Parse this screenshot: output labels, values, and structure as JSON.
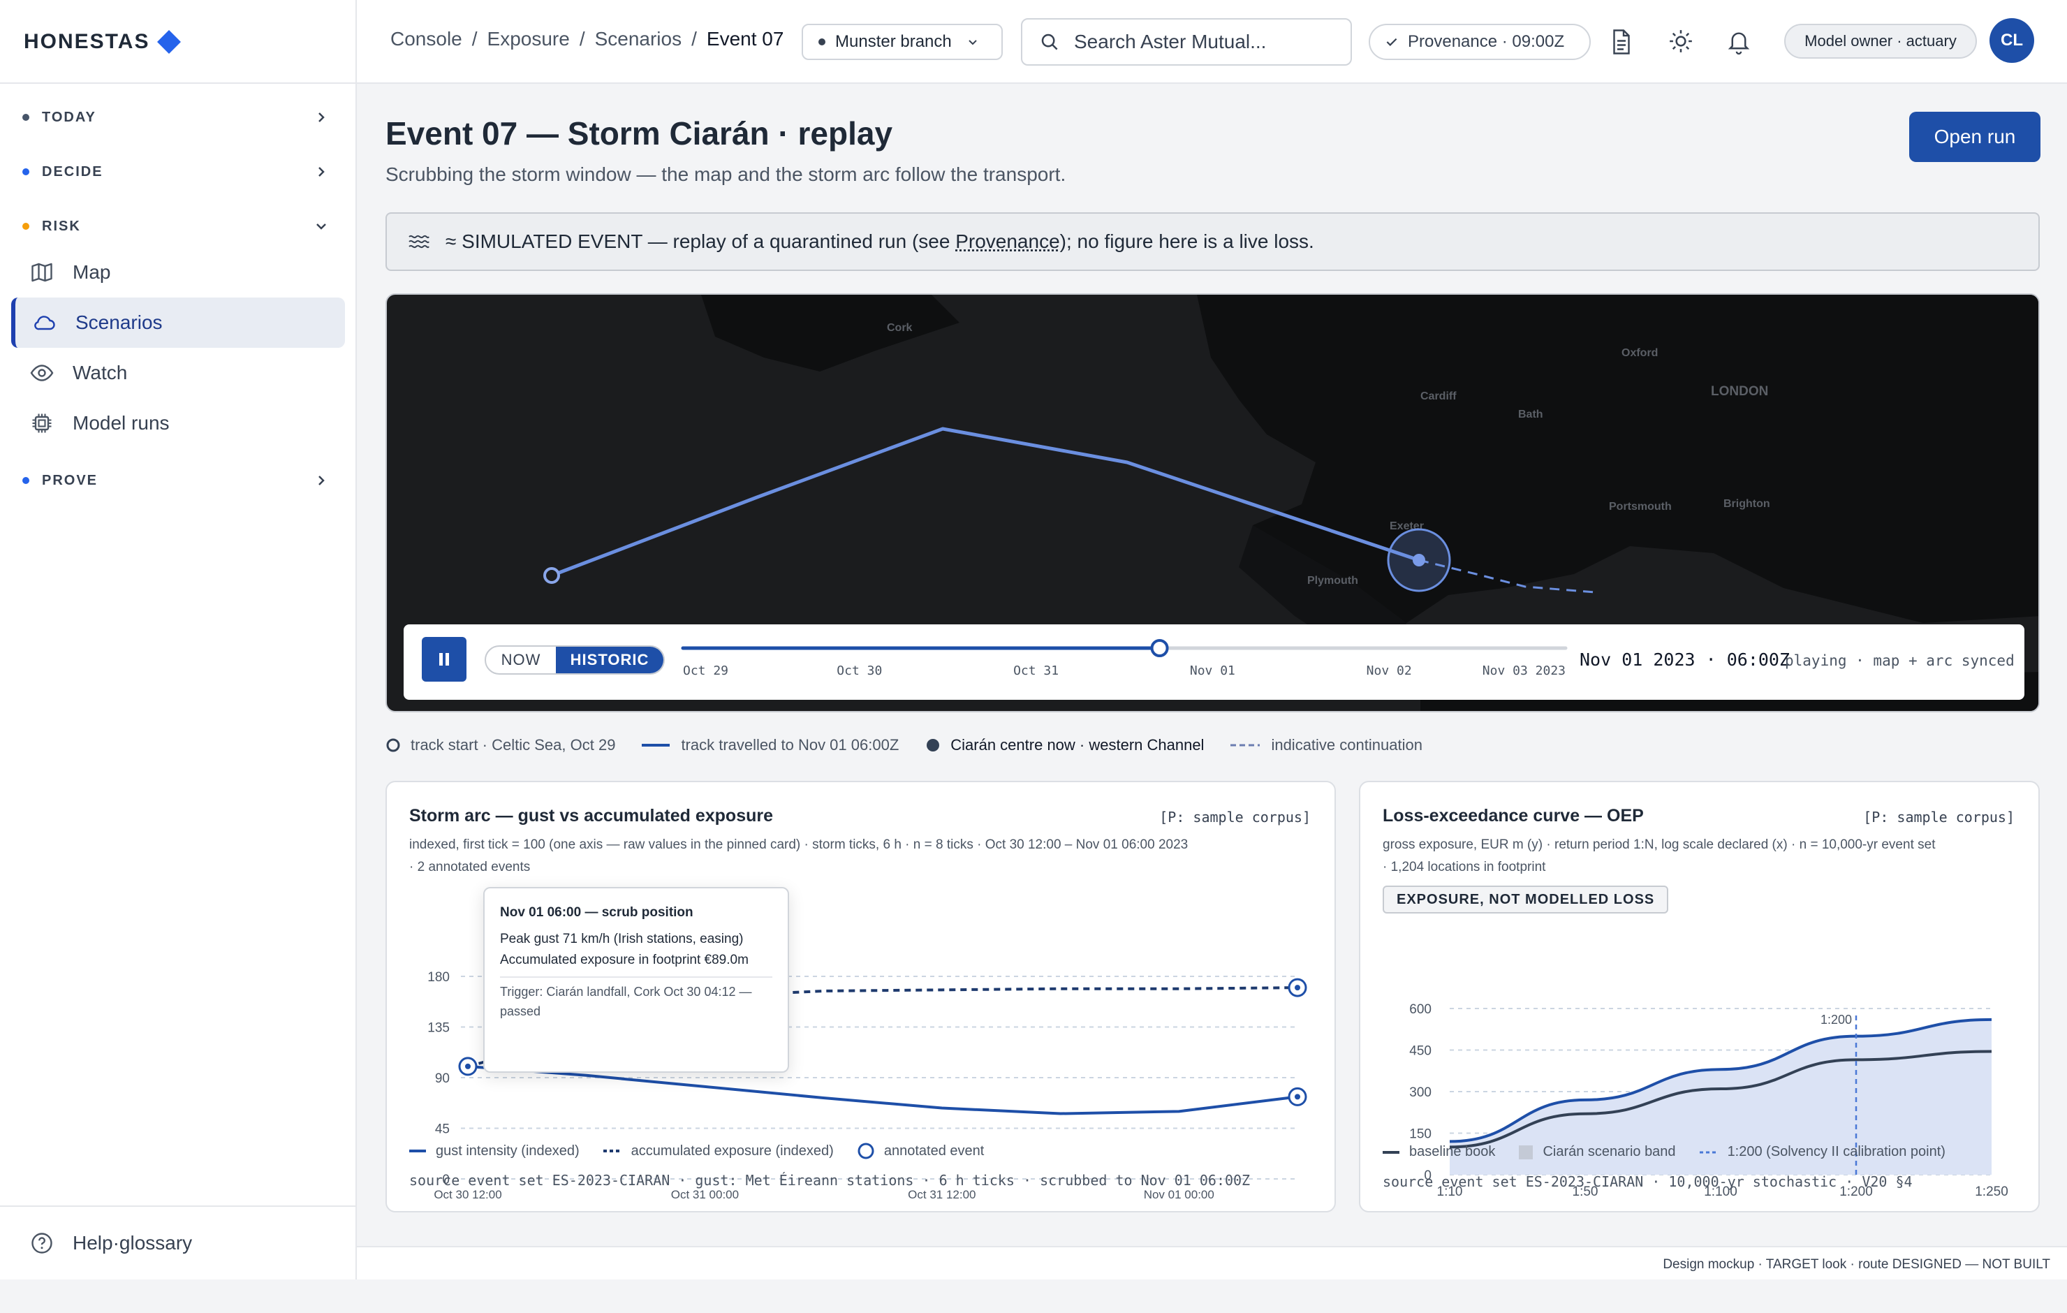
{
  "brand": {
    "name": "HONESTAS"
  },
  "sidebar": {
    "groups": [
      {
        "label": "TODAY",
        "color": "#475569"
      },
      {
        "label": "DECIDE",
        "color": "#2563eb"
      },
      {
        "label": "RISK",
        "color": "#f59e0b"
      },
      {
        "label": "PROVE",
        "color": "#2563eb"
      }
    ],
    "items": [
      {
        "label": "Map",
        "icon": "map-icon"
      },
      {
        "label": "Scenarios",
        "icon": "cloud-icon",
        "active": true
      },
      {
        "label": "Watch",
        "icon": "eye-icon"
      },
      {
        "label": "Model runs",
        "icon": "chip-icon"
      }
    ],
    "help": "Help·glossary"
  },
  "topbar": {
    "crumbs": [
      "Console",
      "Exposure",
      "Scenarios",
      "Event 07"
    ],
    "separator": "/",
    "branch": "Munster branch",
    "search_placeholder": "Search Aster Mutual...",
    "provenance": "Provenance · 09:00Z",
    "role": "Model owner · actuary",
    "avatar": "CL"
  },
  "page": {
    "title": "Event 07 — Storm Ciarán · replay",
    "subtitle": "Scrubbing the storm window — the map and the storm arc follow the transport.",
    "open_run": "Open run",
    "banner_prefix": "≈ SIMULATED EVENT — replay of a quarantined run (see ",
    "banner_link": "Provenance",
    "banner_suffix": "); no figure here is a live loss."
  },
  "map": {
    "places": [
      "Cork",
      "Oxford",
      "Cardiff",
      "LONDON",
      "Bath",
      "Exeter",
      "Portsmouth",
      "Brighton",
      "Plymouth"
    ],
    "transport": {
      "now_label": "NOW",
      "historic_label": "HISTORIC",
      "ticks": [
        "Oct 29",
        "Oct 30",
        "Oct 31",
        "Nov 01",
        "Nov 02",
        "Nov 03 2023"
      ],
      "position_fraction": 0.54,
      "timestamp": "Nov 01 2023 · 06:00Z",
      "status": "playing · map + arc synced"
    },
    "legend": [
      {
        "label": "track start · Celtic Sea, Oct 29"
      },
      {
        "label": "track travelled to Nov 01 06:00Z"
      },
      {
        "label": "Ciarán centre now · western Channel"
      },
      {
        "label": "indicative continuation"
      }
    ]
  },
  "card1": {
    "title": "Storm arc — gust vs accumulated exposure",
    "tag": "[P: sample corpus]",
    "desc1": "indexed, first tick = 100 (one axis — raw values in the pinned card) · storm ticks, 6 h · n = 8 ticks · Oct 30 12:00 – Nov 01 06:00 2023",
    "desc2": "· 2 annotated events",
    "tooltip": {
      "heading": "Nov 01 06:00 — scrub position",
      "line1": "Peak gust 71 km/h (Irish stations, easing)",
      "line2": "Accumulated exposure in footprint €89.0m",
      "trigger": "Trigger: Ciarán landfall, Cork Oct 30 04:12 — passed"
    },
    "legend": [
      "gust intensity (indexed)",
      "accumulated exposure (indexed)",
      "annotated event"
    ],
    "source": "source event set ES-2023-CIARAN · gust: Met Éireann stations · 6 h ticks · scrubbed to Nov 01 06:00Z"
  },
  "card2": {
    "title": "Loss-exceedance curve — OEP",
    "tag": "[P: sample corpus]",
    "desc1": "gross exposure, EUR m (y) · return period 1:N, log scale declared (x) · n = 10,000-yr event set",
    "desc2": "· 1,204 locations in footprint",
    "badge": "EXPOSURE, NOT MODELLED LOSS",
    "legend": [
      "baseline book",
      "Ciarán scenario band",
      "1:200 (Solvency II calibration point)"
    ],
    "source": "source event set ES-2023-CIARAN · 10,000-yr stochastic · V20 §4"
  },
  "footer": {
    "note": "Design mockup · TARGET look · route DESIGNED — NOT BUILT"
  },
  "colors": {
    "accent": "#1e4fa8",
    "track": "#6b8fe0",
    "line": "#1e4fa8",
    "baseline": "#334155",
    "band": "#dbe3f5"
  },
  "chart_data": [
    {
      "type": "line",
      "title": "Storm arc — gust vs accumulated exposure",
      "x_ticks": [
        "Oct 30 12:00",
        "Oct 31 00:00",
        "Oct 31 12:00",
        "Nov 01 00:00"
      ],
      "x": [
        "Oct 30 12:00",
        "Oct 30 18:00",
        "Oct 31 00:00",
        "Oct 31 06:00",
        "Oct 31 12:00",
        "Oct 31 18:00",
        "Nov 01 00:00",
        "Nov 01 06:00"
      ],
      "ylim": [
        0,
        180
      ],
      "y_ticks": [
        0,
        45,
        90,
        135,
        180
      ],
      "series": [
        {
          "name": "gust intensity (indexed)",
          "values": [
            100,
            92,
            82,
            72,
            63,
            58,
            60,
            73
          ],
          "style": "solid"
        },
        {
          "name": "accumulated exposure (indexed)",
          "values": [
            100,
            128,
            162,
            167,
            168,
            169,
            169,
            170
          ],
          "style": "dashed"
        }
      ],
      "annotated_events": [
        {
          "x": "Oct 30 12:00",
          "y": 100
        },
        {
          "x": "Nov 01 06:00",
          "y": 170
        },
        {
          "x": "Nov 01 06:00",
          "y": 73
        }
      ]
    },
    {
      "type": "area",
      "title": "Loss-exceedance curve — OEP",
      "x_ticks": [
        "1:10",
        "1:50",
        "1:100",
        "1:200",
        "1:250"
      ],
      "ylim": [
        0,
        600
      ],
      "y_ticks": [
        0,
        150,
        300,
        450,
        600
      ],
      "series": [
        {
          "name": "Ciarán scenario band",
          "values": [
            120,
            270,
            380,
            500,
            560
          ]
        },
        {
          "name": "baseline book",
          "values": [
            100,
            220,
            310,
            415,
            445
          ]
        }
      ],
      "reference": {
        "label": "1:200",
        "x": "1:200"
      }
    }
  ]
}
